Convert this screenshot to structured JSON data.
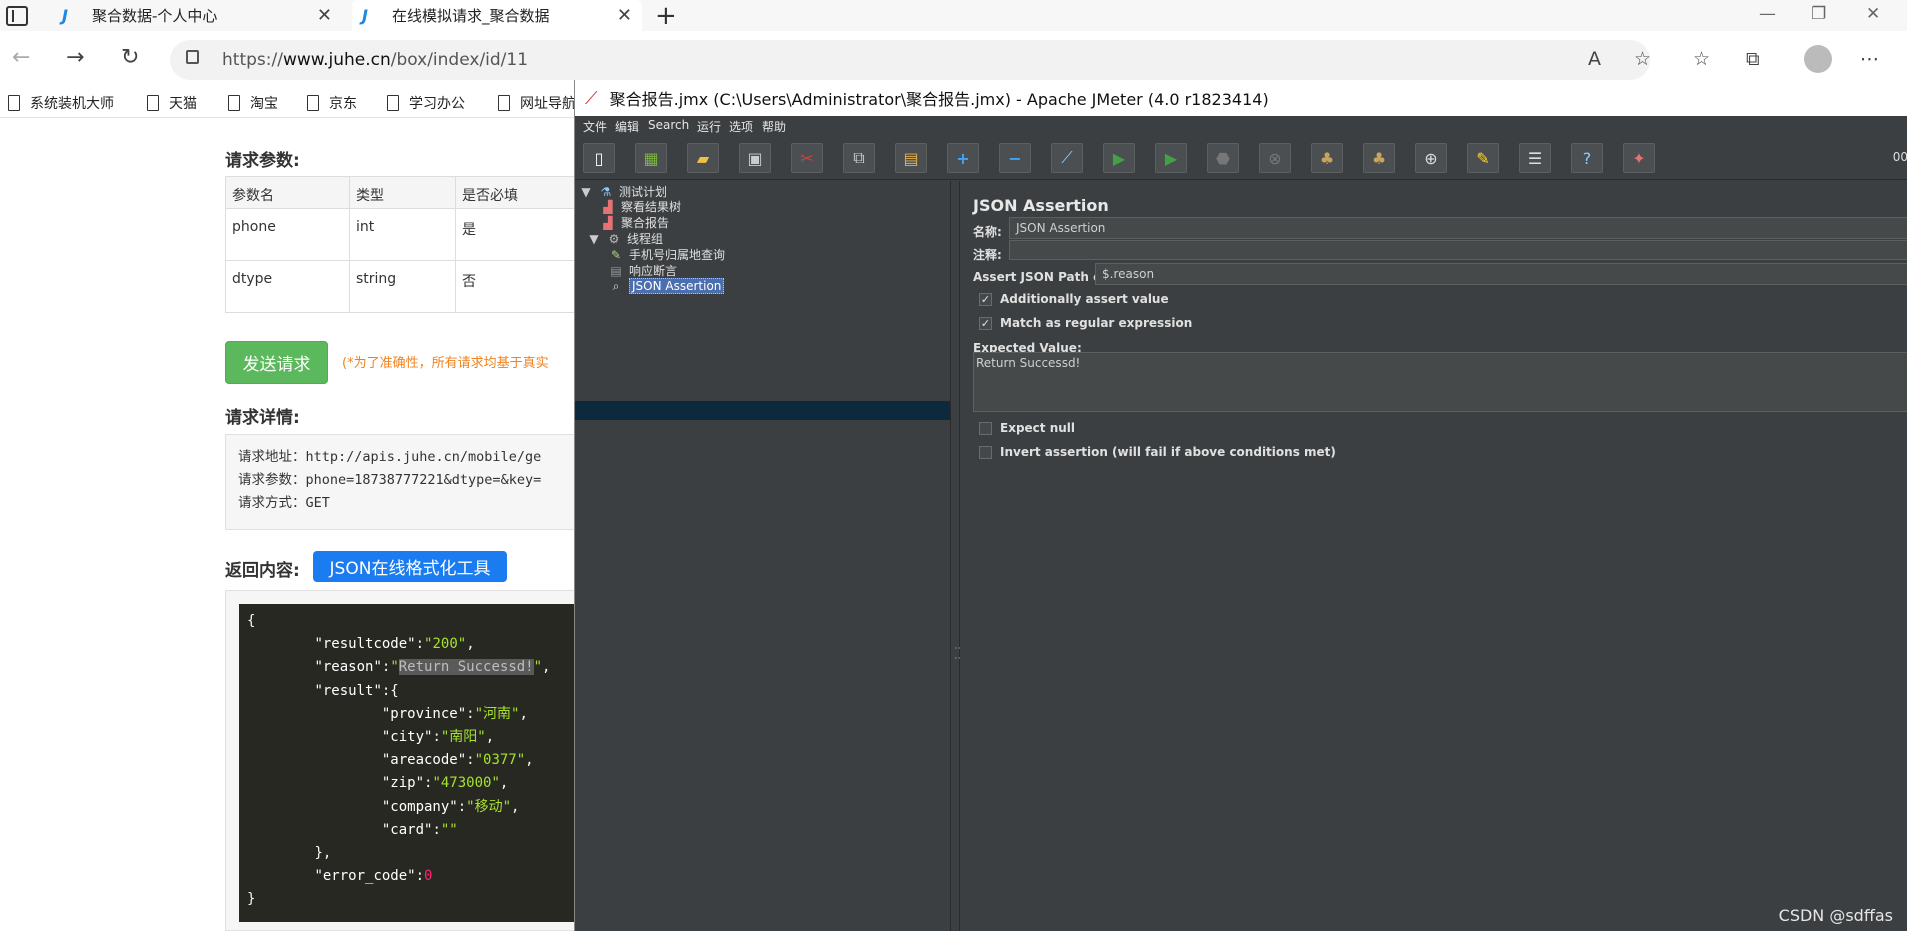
{
  "browser": {
    "tabs": [
      {
        "logo": "J",
        "title": "聚合数据-个人中心"
      },
      {
        "logo": "J",
        "title": "在线模拟请求_聚合数据"
      }
    ],
    "new_tab": "+",
    "url_prefix": "https://",
    "url_domain": "www.juhe.cn",
    "url_path": "/box/index/id/11",
    "favorites": [
      "系统装机大师",
      "天猫",
      "淘宝",
      "京东",
      "学习办公",
      "网址导航"
    ]
  },
  "page": {
    "params_heading": "请求参数:",
    "params_table": {
      "headers": [
        "参数名",
        "类型",
        "是否必填"
      ],
      "rows": [
        [
          "phone",
          "int",
          "是"
        ],
        [
          "dtype",
          "string",
          "否"
        ]
      ]
    },
    "send_button": "发送请求",
    "note": "(*为了准确性，所有请求均基于真实",
    "detail_heading": "请求详情:",
    "detail_lines": [
      "请求地址：http://apis.juhe.cn/mobile/ge",
      "请求参数：phone=18738777221&dtype=&key=",
      "请求方式：GET"
    ],
    "return_heading": "返回内容:",
    "json_tool_button": "JSON在线格式化工具",
    "json": {
      "open": "{",
      "resultcode_key": "\"resultcode\"",
      "resultcode_val": "\"200\"",
      "reason_key": "\"reason\"",
      "reason_q": "\"",
      "reason_val": "Return Successd!",
      "result_key": "\"result\"",
      "province_key": "\"province\"",
      "province_val": "\"河南\"",
      "city_key": "\"city\"",
      "city_val": "\"南阳\"",
      "areacode_key": "\"areacode\"",
      "areacode_val": "\"0377\"",
      "zip_key": "\"zip\"",
      "zip_val": "\"473000\"",
      "company_key": "\"company\"",
      "company_val": "\"移动\"",
      "card_key": "\"card\"",
      "card_val": "\"\"",
      "result_close": "},",
      "error_code_key": "\"error_code\"",
      "error_code_val": "0",
      "close": "}"
    }
  },
  "jmeter": {
    "title": "聚合报告.jmx (C:\\Users\\Administrator\\聚合报告.jmx) - Apache JMeter (4.0 r1823414)",
    "menu": [
      "文件",
      "编辑",
      "Search",
      "运行",
      "选项",
      "帮助"
    ],
    "toolbar_counter": "00",
    "tree": [
      {
        "label": "测试计划",
        "icon": "flask-icon"
      },
      {
        "label": "察看结果树",
        "icon": "chart-icon"
      },
      {
        "label": "聚合报告",
        "icon": "chart-icon"
      },
      {
        "label": "线程组",
        "icon": "gear-icon"
      },
      {
        "label": "手机号归属地查询",
        "icon": "pen-icon"
      },
      {
        "label": "响应断言",
        "icon": "doc-icon"
      },
      {
        "label": "JSON Assertion",
        "icon": "search-doc-icon"
      }
    ],
    "panel": {
      "title": "JSON Assertion",
      "name_label": "名称:",
      "name_value": "JSON Assertion",
      "comment_label": "注释:",
      "comment_value": "",
      "path_label": "Assert JSON Path exists:",
      "path_value": "$.reason",
      "additionally_assert": "Additionally assert value",
      "match_regex": "Match as regular expression",
      "expected_label": "Expected Value:",
      "expected_value": "Return Successd!",
      "expect_null": "Expect null",
      "invert": "Invert assertion (will fail if above conditions met)"
    }
  },
  "watermark": "CSDN @sdffas"
}
